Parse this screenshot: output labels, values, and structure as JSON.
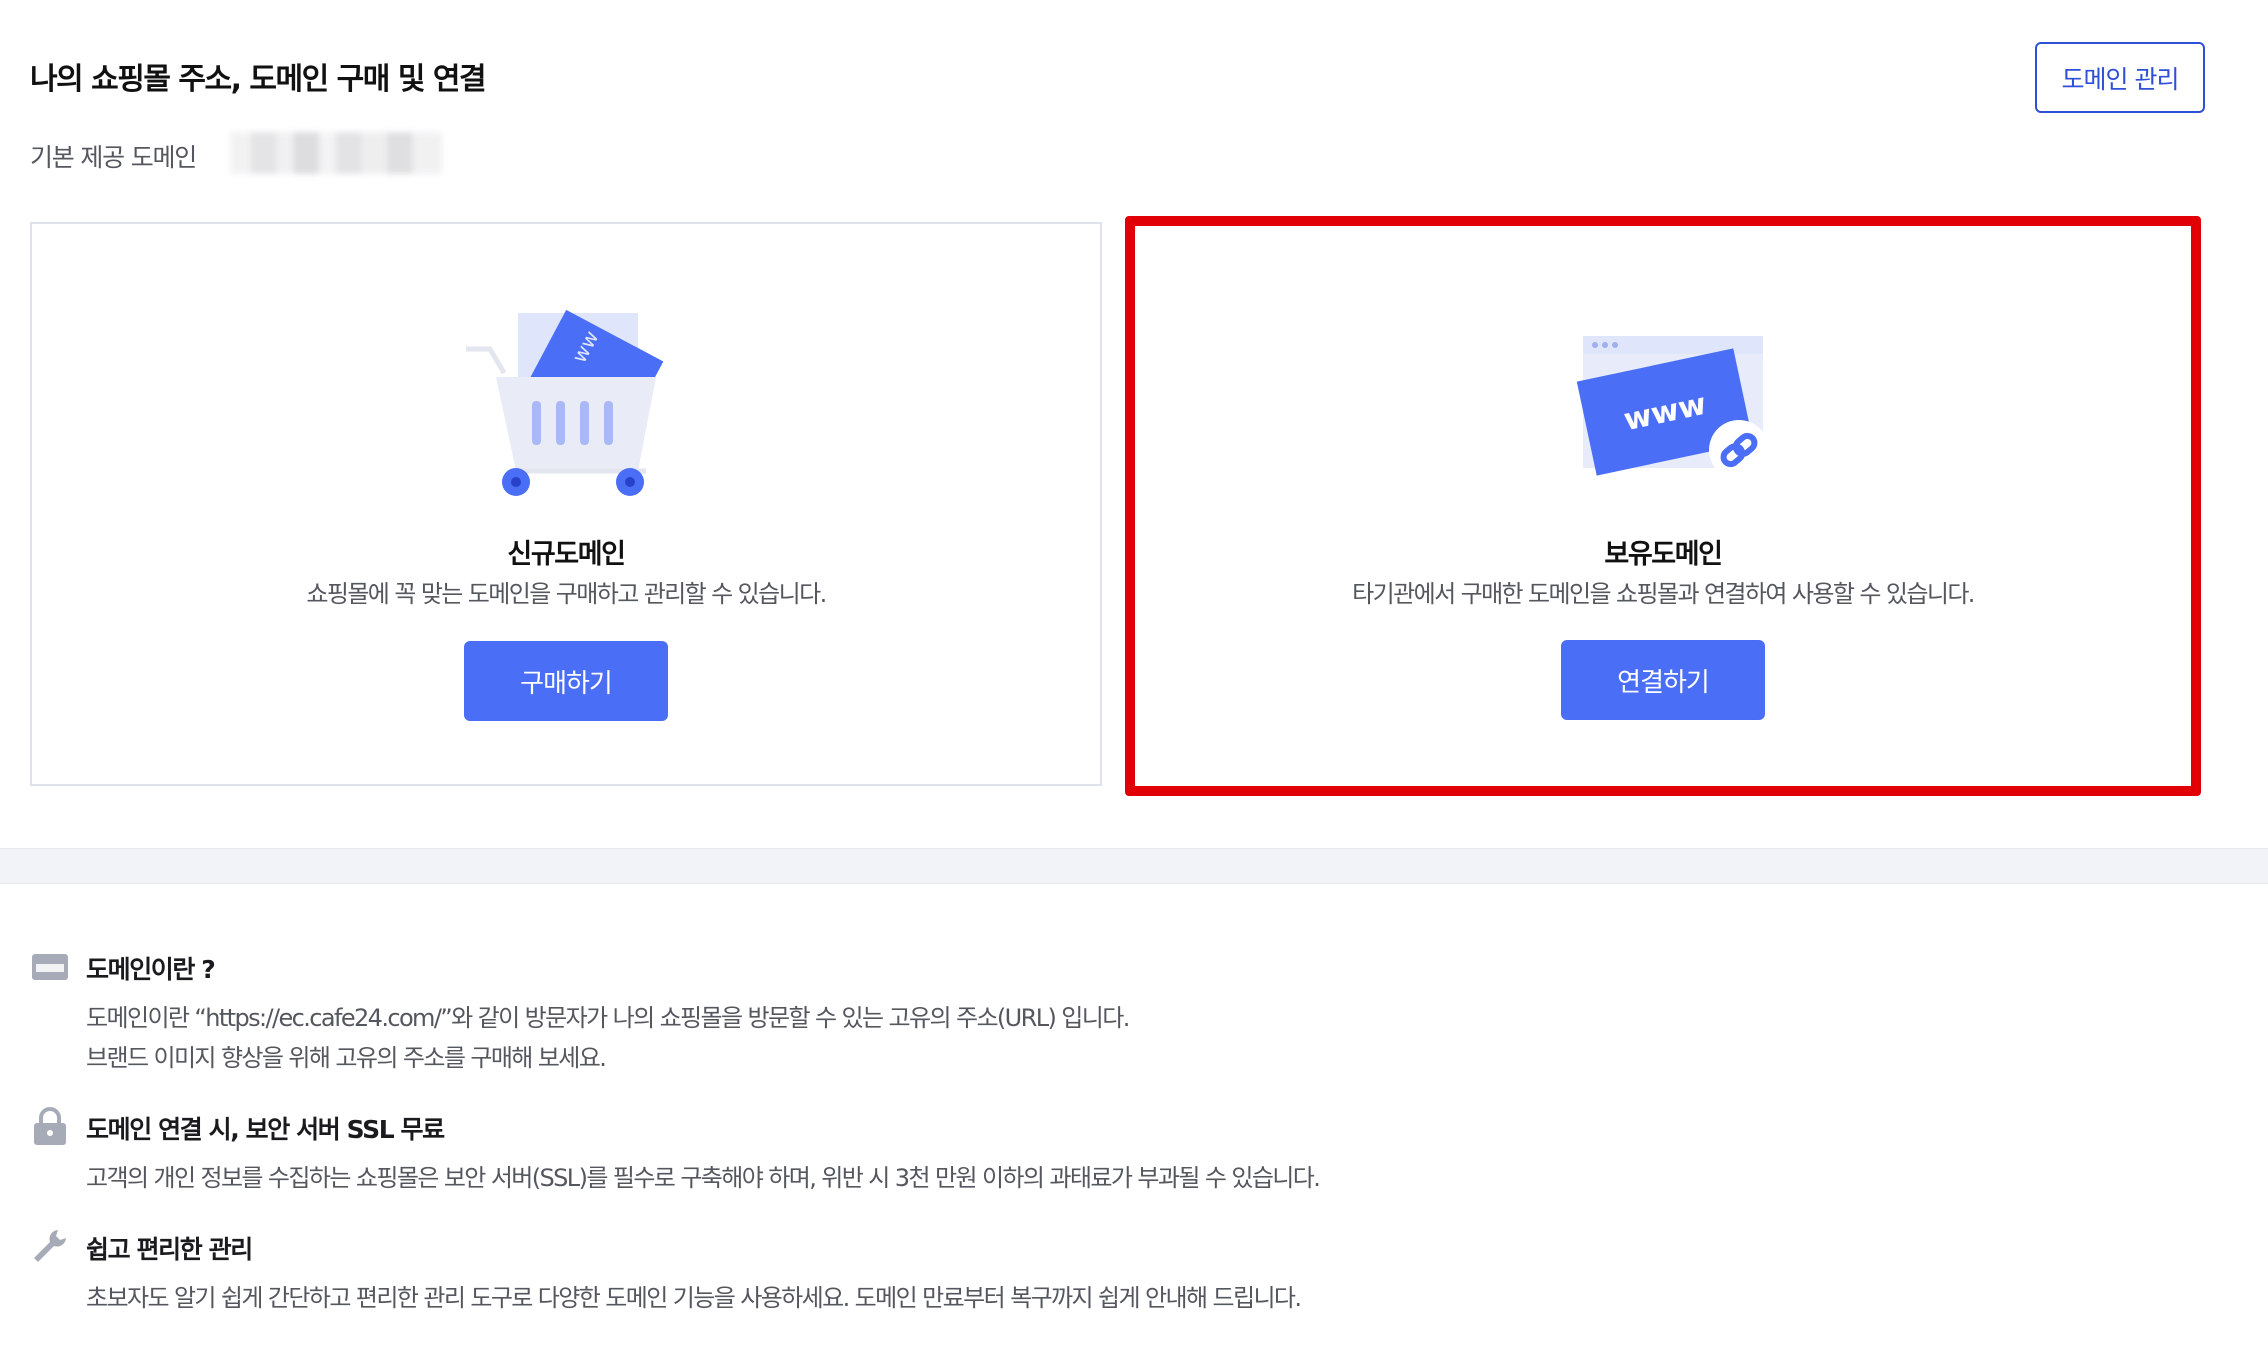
{
  "header": {
    "title": "나의 쇼핑몰 주소, 도메인 구매 및 연결",
    "manage_button": "도메인 관리",
    "default_domain_label": "기본 제공 도메인"
  },
  "cards": {
    "new": {
      "title": "신규도메인",
      "description": "쇼핑몰에 꼭 맞는 도메인을 구매하고 관리할 수 있습니다.",
      "button": "구매하기",
      "icon": "shopping-cart-icon"
    },
    "owned": {
      "title": "보유도메인",
      "description": "타기관에서 구매한 도메인을 쇼핑몰과 연결하여 사용할 수 있습니다.",
      "button": "연결하기",
      "icon": "www-link-icon",
      "illustration_text": "www",
      "highlight_color": "#e00006"
    }
  },
  "info": {
    "items": [
      {
        "icon": "www-card-icon",
        "title": "도메인이란 ?",
        "lines": [
          "도메인이란 “https://ec.cafe24.com/”와 같이 방문자가 나의 쇼핑몰을 방문할 수 있는 고유의 주소(URL) 입니다.",
          "브랜드 이미지 향상을 위해 고유의 주소를 구매해 보세요."
        ]
      },
      {
        "icon": "lock-icon",
        "title": "도메인 연결 시, 보안 서버 SSL 무료",
        "lines": [
          "고객의 개인 정보를 수집하는 쇼핑몰은 보안 서버(SSL)를 필수로 구축해야 하며, 위반 시 3천 만원 이하의 과태료가 부과될 수 있습니다."
        ]
      },
      {
        "icon": "wrench-icon",
        "title": "쉽고 편리한 관리",
        "lines": [
          "초보자도 알기 쉽게 간단하고 편리한 관리 도구로 다양한 도메인 기능을 사용하세요. 도메인 만료부터 복구까지 쉽게 안내해 드립니다."
        ]
      }
    ]
  },
  "colors": {
    "accent": "#4a6ef6",
    "manage_button_border": "#2f4fd6",
    "highlight": "#e00006"
  }
}
